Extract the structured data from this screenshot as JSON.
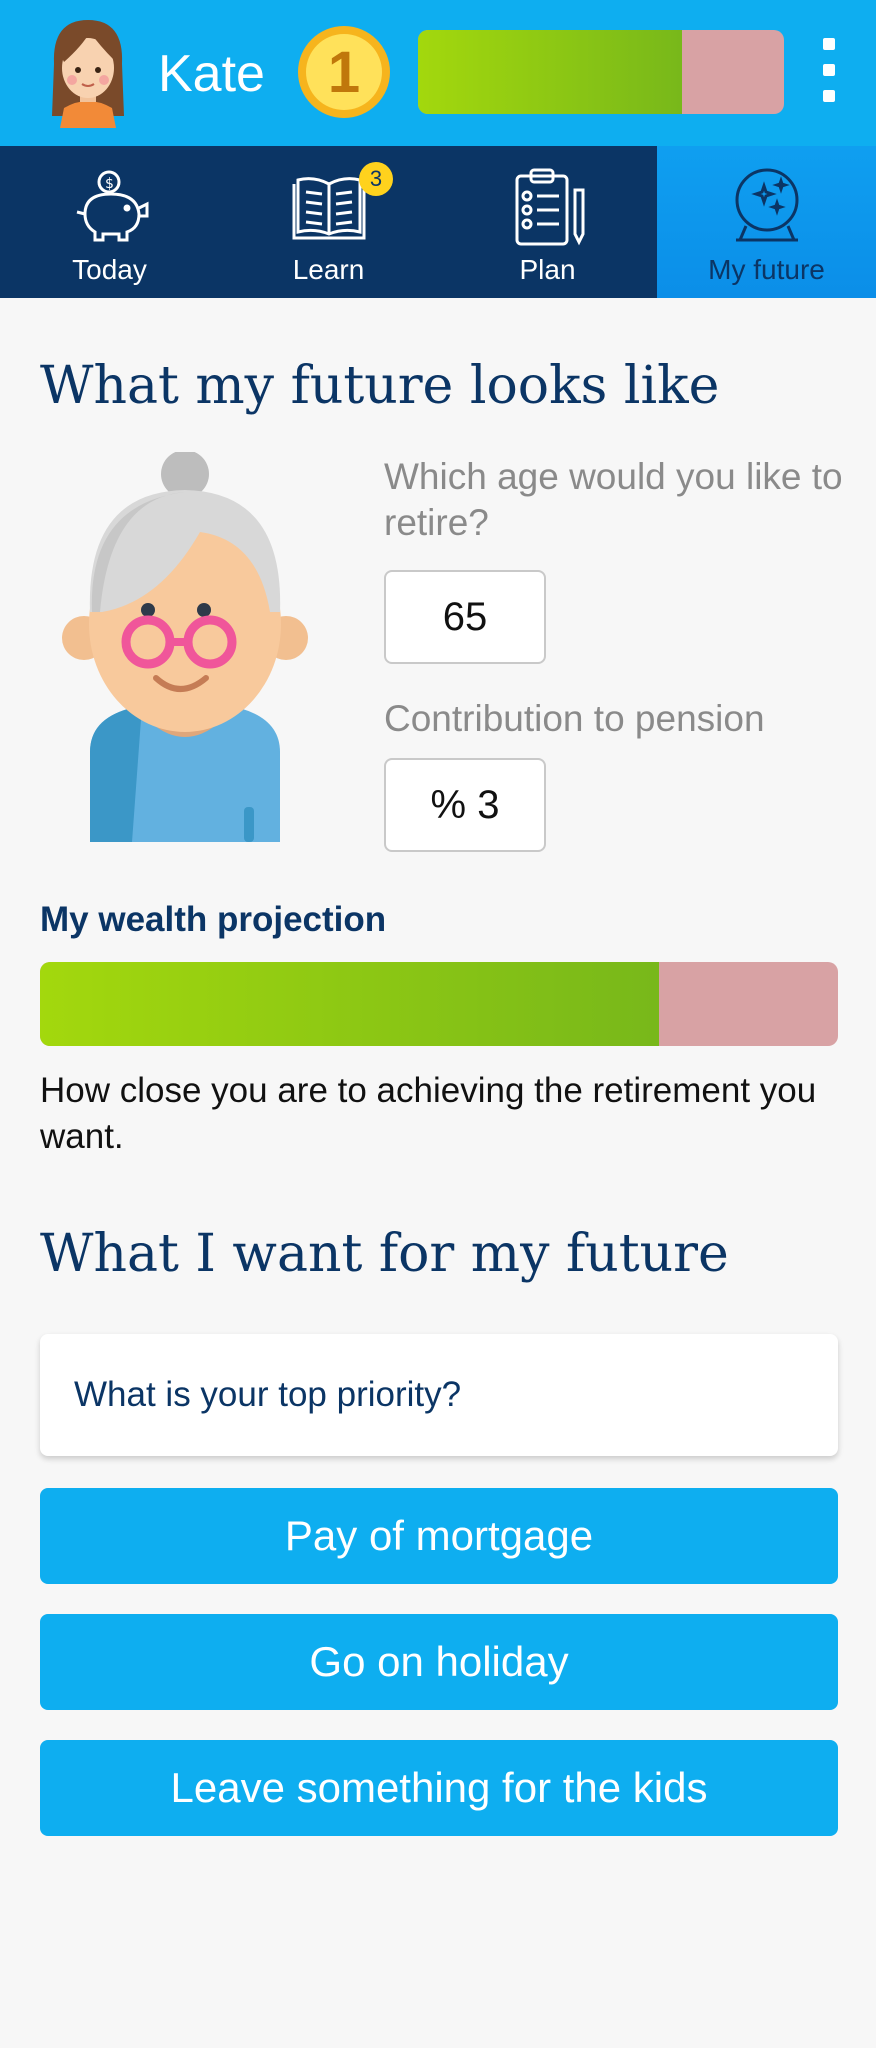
{
  "header": {
    "username": "Kate",
    "level": "1",
    "progress": 0.72,
    "colors": {
      "bar": "#0eaef0",
      "progress_fill": "#8ccb14",
      "progress_empty": "#d8a2a4"
    }
  },
  "tabs": [
    {
      "label": "Today",
      "icon": "piggy-bank-icon",
      "active": false
    },
    {
      "label": "Learn",
      "icon": "book-icon",
      "badge": "3",
      "active": false
    },
    {
      "label": "Plan",
      "icon": "clipboard-icon",
      "active": false
    },
    {
      "label": "My future",
      "icon": "crystal-ball-icon",
      "active": true
    }
  ],
  "future": {
    "title": "What my future looks like",
    "retire_age_label": "Which age would you like to retire?",
    "retire_age_value": "65",
    "contribution_label": "Contribution to pension",
    "contribution_value": "% 3"
  },
  "wealth": {
    "title": "My wealth projection",
    "progress": 0.776,
    "description": "How close you are to achieving the retirement you want."
  },
  "wants": {
    "title": "What I want for my future",
    "prompt": "What is your top priority?",
    "options": [
      "Pay of mortgage",
      "Go on holiday",
      "Leave something for the kids"
    ]
  }
}
